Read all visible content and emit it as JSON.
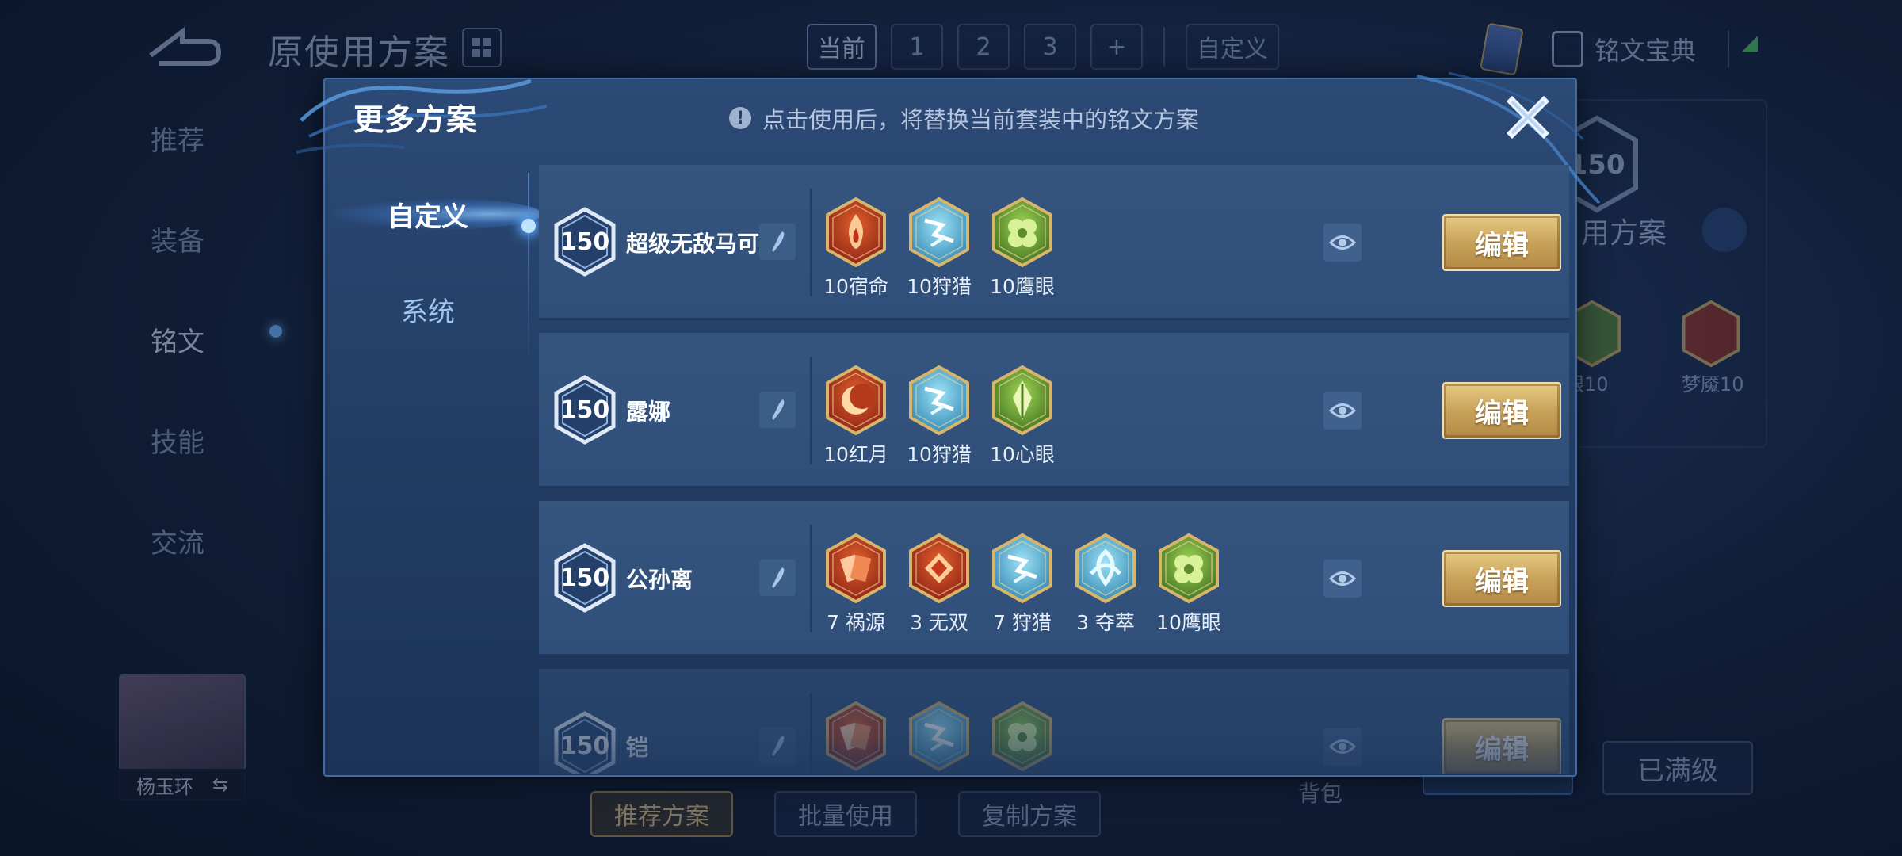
{
  "background": {
    "title": "原使用方案",
    "tabs": [
      {
        "label": "当前",
        "active": true
      },
      {
        "label": "1",
        "active": false
      },
      {
        "label": "2",
        "active": false
      },
      {
        "label": "3",
        "active": false
      },
      {
        "label": "+",
        "active": false
      },
      {
        "label": "自定义",
        "active": false
      }
    ],
    "rune_book": "铭文宝典",
    "sidebar": [
      "推荐",
      "装备",
      "铭文",
      "技能",
      "交流"
    ],
    "hero_name": "杨玉环",
    "bottom_buttons": [
      "推荐方案",
      "批量使用",
      "复制方案"
    ],
    "bag": "背包",
    "maxed": "已满级",
    "right_panel": {
      "level": "150",
      "plan_text": "用方案",
      "rune_labels": [
        "眼10",
        "梦魇10"
      ]
    }
  },
  "modal": {
    "title": "更多方案",
    "notice": "点击使用后，将替换当前套装中的铭文方案",
    "tabs": [
      {
        "label": "自定义",
        "active": true
      },
      {
        "label": "系统",
        "active": false
      }
    ],
    "edit_label": "编辑",
    "plans": [
      {
        "level": "150",
        "name": "超级无敌马可",
        "runes": [
          {
            "icon": "fire-flame-rune-icon",
            "label": "10宿命",
            "color": "red"
          },
          {
            "icon": "lightning-rune-icon",
            "label": "10狩猎",
            "color": "blue"
          },
          {
            "icon": "clover-rune-icon",
            "label": "10鹰眼",
            "color": "green"
          }
        ]
      },
      {
        "level": "150",
        "name": "露娜",
        "runes": [
          {
            "icon": "crescent-moon-rune-icon",
            "label": "10红月",
            "color": "red"
          },
          {
            "icon": "lightning-rune-icon",
            "label": "10狩猎",
            "color": "blue"
          },
          {
            "icon": "leaf-rune-icon",
            "label": "10心眼",
            "color": "green"
          }
        ]
      },
      {
        "level": "150",
        "name": "公孙离",
        "runes": [
          {
            "icon": "cards-rune-icon",
            "label": "7 祸源",
            "color": "red"
          },
          {
            "icon": "diamond-rune-icon",
            "label": "3 无双",
            "color": "red"
          },
          {
            "icon": "lightning-rune-icon",
            "label": "7 狩猎",
            "color": "blue"
          },
          {
            "icon": "knot-rune-icon",
            "label": "3 夺萃",
            "color": "blue"
          },
          {
            "icon": "clover-rune-icon",
            "label": "10鹰眼",
            "color": "green"
          }
        ]
      },
      {
        "level": "150",
        "name": "铠",
        "runes": [
          {
            "icon": "cards-rune-icon",
            "label": "",
            "color": "red"
          },
          {
            "icon": "lightning-rune-icon",
            "label": "",
            "color": "blue"
          },
          {
            "icon": "clover-rune-icon",
            "label": "",
            "color": "green"
          }
        ]
      }
    ]
  },
  "colors": {
    "modal_bg": "#2c4a76",
    "row_bg": "#35557f",
    "gold": "#c9a25a",
    "accent_blue": "#5aa8ff"
  }
}
